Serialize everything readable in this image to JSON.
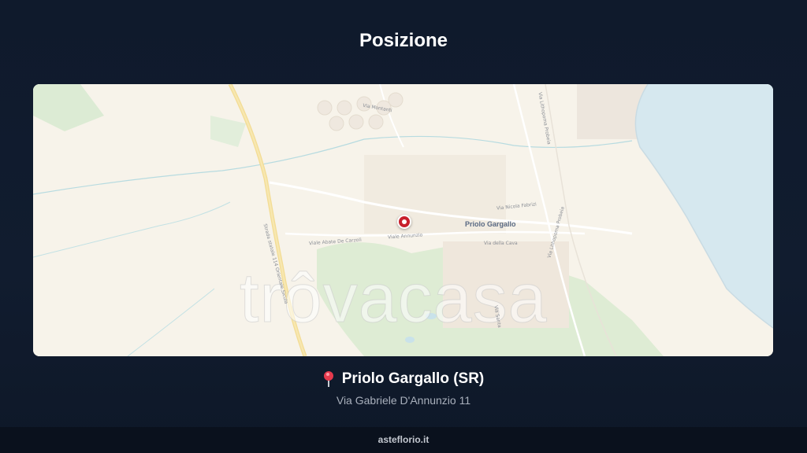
{
  "page": {
    "title": "Posizione"
  },
  "map": {
    "place_label": "Priolo Gargallo",
    "watermark": "trôvacasa",
    "streets": {
      "via_montanti": "Via Montanti",
      "via_lithopoma": "Via Lithopoma Probeia",
      "via_nicola_fabrizi": "Via Nicola Fabrizi",
      "via_abate_de_carzoli": "Viale Abate De Carzoli",
      "viale_annunzio": "Viale Annunzio",
      "via_della_cava": "Via della Cava",
      "strada_statale": "Strada statale 114 Orientale Sicula",
      "via_lithopoma_2": "Via Lithopoma Probeia",
      "via_santa": "Via Santa"
    },
    "pin_icon": "map-marker-icon"
  },
  "location": {
    "icon": "pushpin-icon",
    "name": "Priolo Gargallo (SR)",
    "address": "Via Gabriele D'Annunzio 11"
  },
  "footer": {
    "brand": "asteflorio.it"
  },
  "colors": {
    "background": "#111c2f",
    "footer": "#0a111d",
    "pin": "#c8202c",
    "sea": "#d6e8ef",
    "land": "#f7f3ea",
    "green": "#d7ead2"
  }
}
